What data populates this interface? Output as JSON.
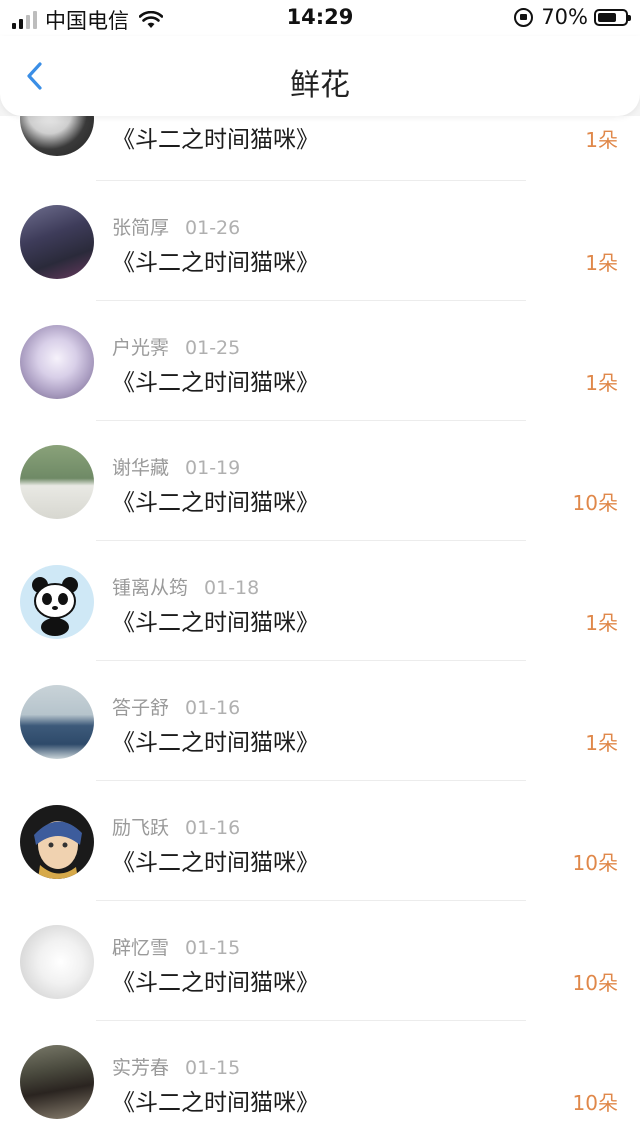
{
  "status_bar": {
    "carrier": "中国电信",
    "time": "14:29",
    "battery": "70%",
    "battery_level": 0.7
  },
  "nav": {
    "title": "鲜花",
    "back_icon": "chevron-left-icon"
  },
  "accent_color": "#e0884a",
  "back_color": "#3a8ee6",
  "first_item": {
    "book": "《斗二之时间猫咪》",
    "count": "1朵"
  },
  "items": [
    {
      "name": "张简厚",
      "date": "01-26",
      "book": "《斗二之时间猫咪》",
      "count": "1朵"
    },
    {
      "name": "户光霁",
      "date": "01-25",
      "book": "《斗二之时间猫咪》",
      "count": "1朵"
    },
    {
      "name": "谢华藏",
      "date": "01-19",
      "book": "《斗二之时间猫咪》",
      "count": "10朵"
    },
    {
      "name": "锺离从筠",
      "date": "01-18",
      "book": "《斗二之时间猫咪》",
      "count": "1朵"
    },
    {
      "name": "答子舒",
      "date": "01-16",
      "book": "《斗二之时间猫咪》",
      "count": "1朵"
    },
    {
      "name": "励飞跃",
      "date": "01-16",
      "book": "《斗二之时间猫咪》",
      "count": "10朵"
    },
    {
      "name": "辟忆雪",
      "date": "01-15",
      "book": "《斗二之时间猫咪》",
      "count": "10朵"
    },
    {
      "name": "实芳春",
      "date": "01-15",
      "book": "《斗二之时间猫咪》",
      "count": "10朵"
    }
  ]
}
